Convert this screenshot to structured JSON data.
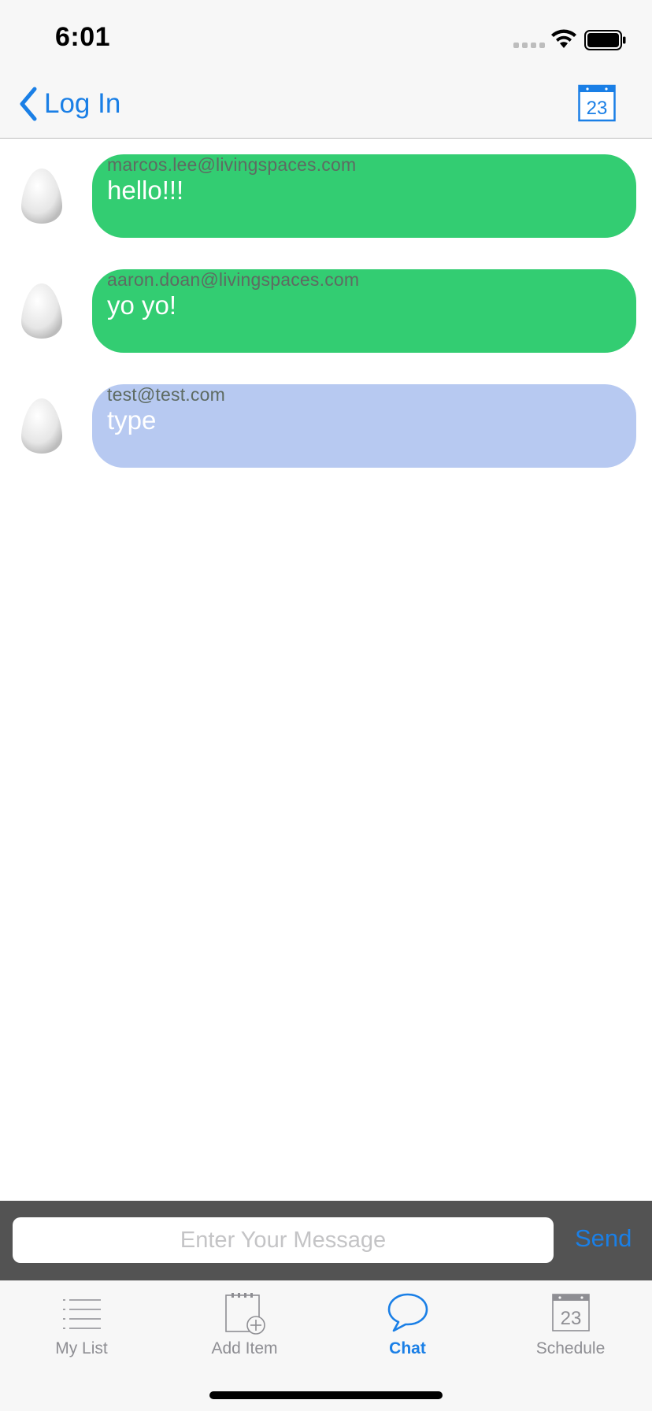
{
  "status_bar": {
    "time": "6:01"
  },
  "nav": {
    "back_label": "Log In",
    "calendar_day": "23"
  },
  "messages": [
    {
      "sender": "marcos.lee@livingspaces.com",
      "text": "hello!!!",
      "color": "#33cd72"
    },
    {
      "sender": "aaron.doan@livingspaces.com",
      "text": "yo yo!",
      "color": "#33cd72"
    },
    {
      "sender": "test@test.com",
      "text": "type",
      "color": "#b7c9f1"
    }
  ],
  "composer": {
    "placeholder": "Enter Your Message",
    "value": "",
    "send_label": "Send"
  },
  "tabs": [
    {
      "label": "My List",
      "icon": "list-icon",
      "active": false
    },
    {
      "label": "Add Item",
      "icon": "add-item-icon",
      "active": false
    },
    {
      "label": "Chat",
      "icon": "chat-bubble-icon",
      "active": true
    },
    {
      "label": "Schedule",
      "icon": "calendar-icon",
      "active": false
    }
  ],
  "tab_icon_day": "23",
  "colors": {
    "accent": "#1a7fe6",
    "bar_background": "#f7f7f7",
    "input_bar": "#535353",
    "tab_inactive": "#8e8e93"
  }
}
